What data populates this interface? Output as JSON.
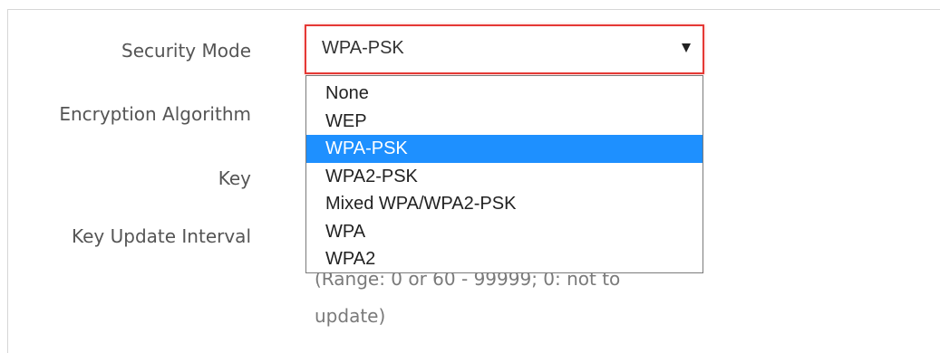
{
  "form": {
    "labels": {
      "security_mode": "Security Mode",
      "encryption_algorithm": "Encryption Algorithm",
      "key": "Key",
      "key_update_interval": "Key Update Interval"
    },
    "security_mode": {
      "value": "WPA-PSK",
      "options": [
        "None",
        "WEP",
        "WPA-PSK",
        "WPA2-PSK",
        "Mixed WPA/WPA2-PSK",
        "WPA",
        "WPA2"
      ],
      "selected_index": 2
    },
    "key_update_interval_hint": {
      "line1": "(Range: 0 or 60 - 99999; 0: not to",
      "line2": "update)"
    }
  },
  "colors": {
    "focus_border": "#e53935",
    "selected_option_bg": "#1e90ff",
    "label_text": "#555555",
    "hint_text": "#7a7a7a"
  }
}
